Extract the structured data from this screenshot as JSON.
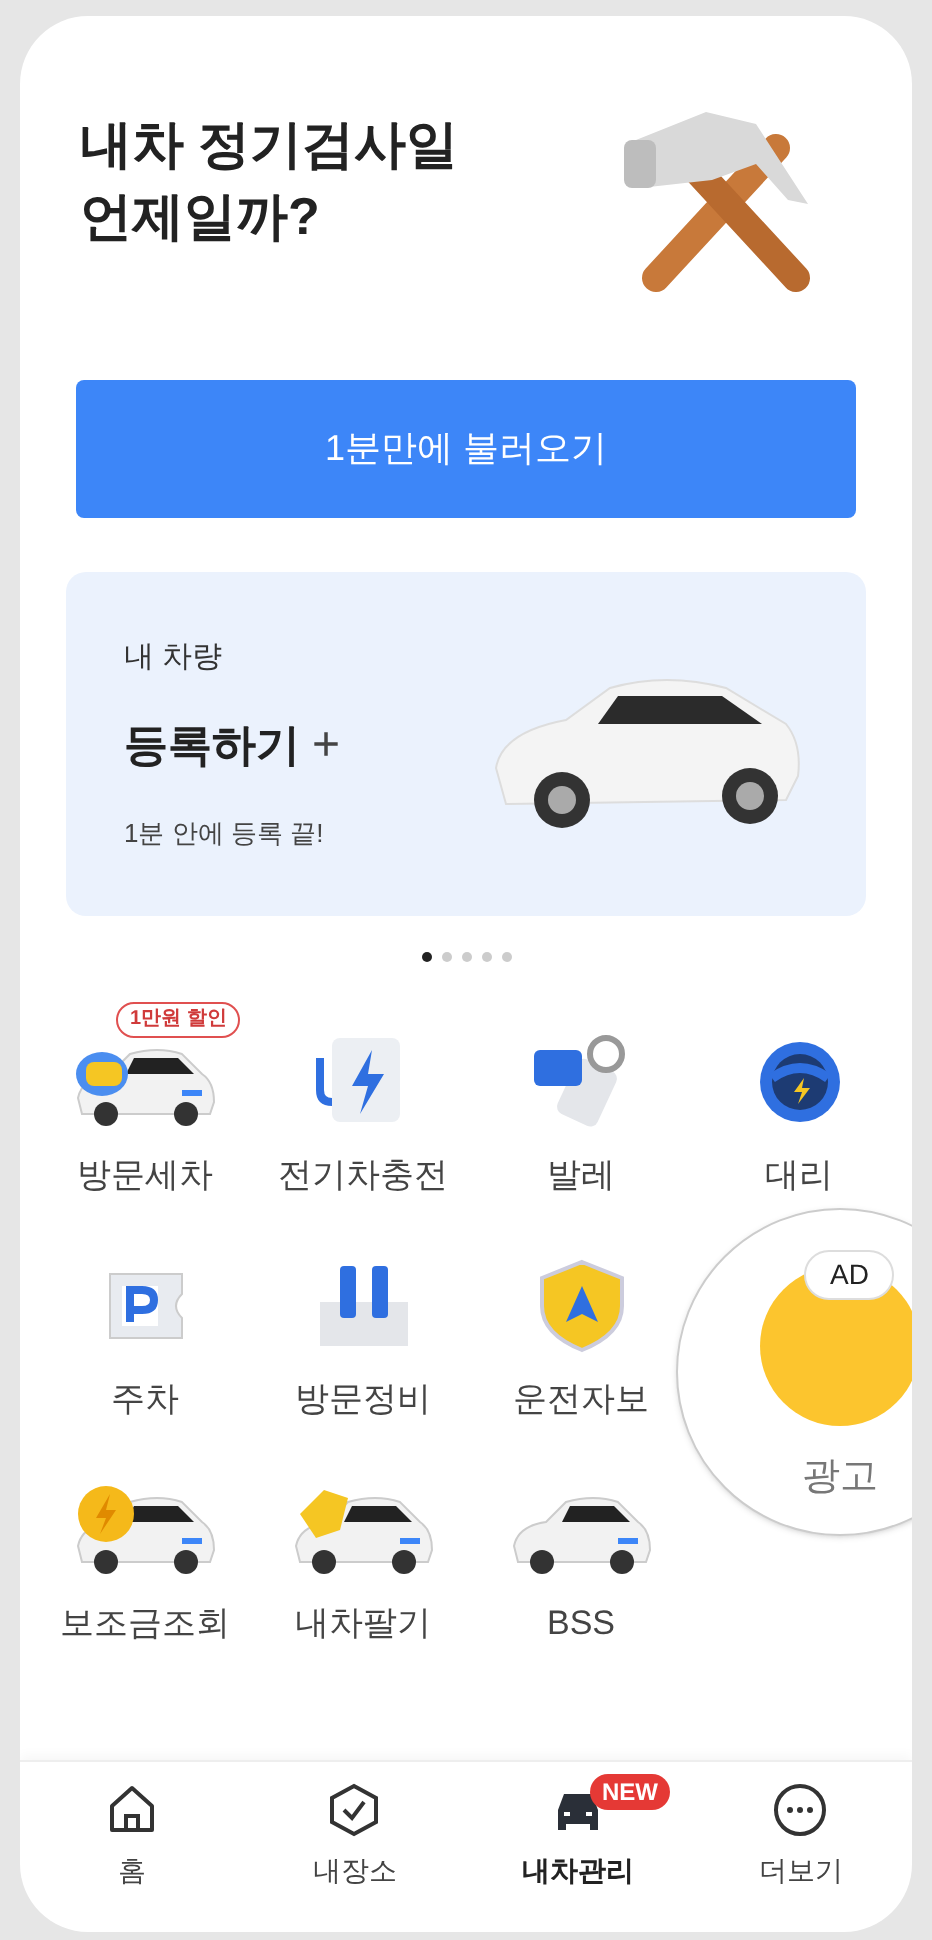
{
  "header": {
    "title_lines": [
      "내차 정기검사일",
      "언제일까?"
    ]
  },
  "cta_button": {
    "label": "1분만에 불러오기"
  },
  "banner": {
    "eyebrow": "내 차량",
    "title": "등록하기",
    "plus": "+",
    "caption": "1분 안에 등록 끝!"
  },
  "carousel_dots": [
    {
      "selected": true
    },
    {
      "selected": false
    },
    {
      "selected": false
    },
    {
      "selected": false
    },
    {
      "selected": false
    }
  ],
  "services": [
    {
      "label": "방문세차",
      "badge": "1만원 할인",
      "kind": "car-wash"
    },
    {
      "label": "전기차충전",
      "kind": "charger"
    },
    {
      "label": "발레",
      "kind": "valet"
    },
    {
      "label": "대리",
      "kind": "driver"
    },
    {
      "label": "주차",
      "kind": "parking"
    },
    {
      "label": "방문정비",
      "kind": "repair"
    },
    {
      "label": "운전자보",
      "kind": "insurance"
    },
    {
      "label": "보조금조회",
      "kind": "subsidy"
    },
    {
      "label": "내차팔기",
      "kind": "sell"
    },
    {
      "label": "BSS",
      "kind": "car"
    }
  ],
  "ad": {
    "badge": "AD",
    "label": "광고"
  },
  "bottom_nav": [
    {
      "label": "홈",
      "kind": "home",
      "selected": false
    },
    {
      "label": "내장소",
      "kind": "places",
      "selected": false
    },
    {
      "label": "내차관리",
      "kind": "car",
      "selected": true,
      "badge": "NEW"
    },
    {
      "label": "더보기",
      "kind": "more",
      "selected": false
    }
  ]
}
